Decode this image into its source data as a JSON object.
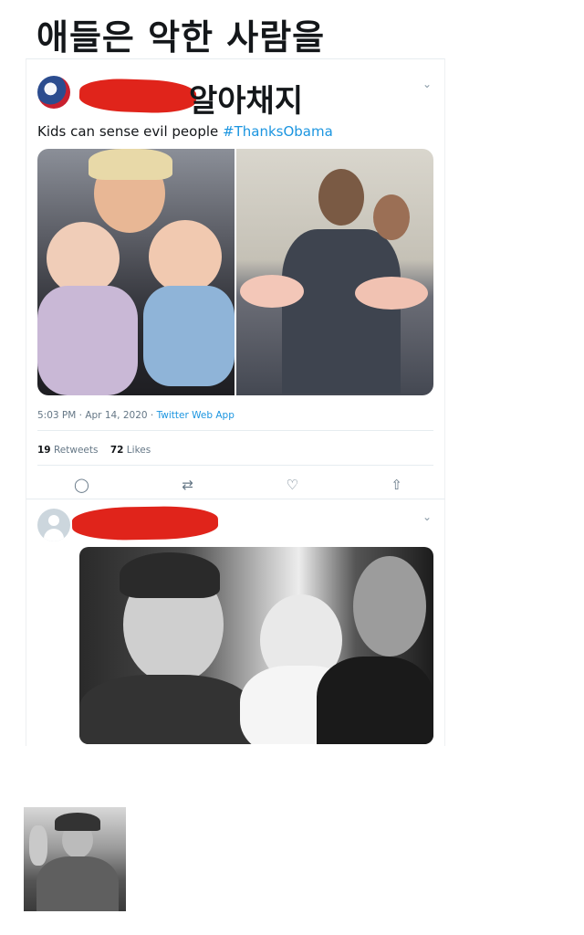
{
  "headline": "애들은 악한 사람을",
  "tweet1": {
    "overlay_text": "알아채지",
    "text": "Kids can sense evil people",
    "hashtag": "#ThanksObama",
    "time": "5:03 PM · Apr 14, 2020",
    "app": "Twitter Web App",
    "retweets_count": "19",
    "retweets_label": "Retweets",
    "likes_count": "72",
    "likes_label": "Likes",
    "icons": [
      "reply-icon",
      "retweet-icon",
      "like-icon",
      "share-icon"
    ]
  },
  "tweet2": {
    "icons": [
      "default-avatar-icon",
      "chevron-down-icon"
    ]
  }
}
